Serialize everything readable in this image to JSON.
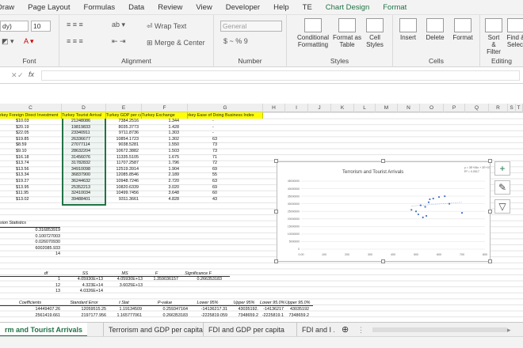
{
  "ribbon_tabs": [
    "Draw",
    "Page Layout",
    "Formulas",
    "Data",
    "Review",
    "View",
    "Developer",
    "Help",
    "TE",
    "Chart Design",
    "Format"
  ],
  "font": {
    "name": "dy)",
    "size": "10",
    "group_label": "Font"
  },
  "alignment": {
    "wrap": "Wrap Text",
    "merge": "Merge & Center",
    "group_label": "Alignment"
  },
  "number": {
    "format": "General",
    "symbols": "$ ~ % 9",
    "group_label": "Number"
  },
  "styles": {
    "cond": "Conditional Formatting",
    "table": "Format as Table",
    "cell": "Cell Styles",
    "group_label": "Styles"
  },
  "cells": {
    "insert": "Insert",
    "delete": "Delete",
    "format": "Format",
    "group_label": "Cells"
  },
  "editing": {
    "sort": "Sort & Filter",
    "find": "Find & Select",
    "group_label": "Editing"
  },
  "formula_bar": {
    "fx": "fx"
  },
  "columns": [
    "C",
    "D",
    "E",
    "F",
    "G",
    "H",
    "I",
    "J",
    "K",
    "L",
    "M",
    "N",
    "O",
    "P",
    "Q",
    "R",
    "S",
    "T"
  ],
  "headers": [
    "rkey Foreign Direct Investment",
    "Turkey Tourist Arrival",
    "Turkey GDP per capit",
    "Turkey Exchange",
    "rkey Ease of Doing Business Index"
  ],
  "rows": [
    [
      "$10.03",
      "21248086",
      "7384.2516",
      "1.344",
      "-"
    ],
    [
      "$20.19",
      "19819833",
      "8035.3773",
      "1.428",
      "-"
    ],
    [
      "$22.05",
      "23340911",
      "9711.8736",
      "1.303",
      "-"
    ],
    [
      "$19.85",
      "26336677",
      "10854.1723",
      "1.302",
      "63"
    ],
    [
      "$8.59",
      "27077114",
      "9038.5281",
      "1.550",
      "73"
    ],
    [
      "$9.10",
      "28632204",
      "10672.3882",
      "1.503",
      "73"
    ],
    [
      "$16.18",
      "31456076",
      "11335.5105",
      "1.675",
      "71"
    ],
    [
      "$13.74",
      "31782832",
      "11707.2587",
      "1.796",
      "72"
    ],
    [
      "$13.56",
      "34910098",
      "12519.3914",
      "1.904",
      "69"
    ],
    [
      "$13.34",
      "36837900",
      "12085.8546",
      "2.189",
      "55"
    ],
    [
      "$19.27",
      "36244632",
      "10948.7246",
      "2.720",
      "63"
    ],
    [
      "$13.95",
      "25352213",
      "10820.6339",
      "3.020",
      "69"
    ],
    [
      "$11.95",
      "32410034",
      "10499.7456",
      "3.648",
      "60"
    ],
    [
      "$13.02",
      "39488401",
      "9311.3661",
      "4.828",
      "43"
    ]
  ],
  "regression": {
    "title": "sion Statistics",
    "stats": [
      "0.316853919",
      "0.100727003",
      "0.026070930",
      "6002085.933",
      "14"
    ],
    "anova_head": [
      "df",
      "SS",
      "MS",
      "F",
      "Significance F"
    ],
    "anova": [
      [
        "1",
        "4.05930E+13",
        "4.05930E+13",
        "1.359036157",
        "0.266353183"
      ],
      [
        "12",
        "4.323E+14",
        "3.6025E+13",
        "",
        ""
      ],
      [
        "13",
        "4.0326E+14",
        "",
        "",
        ""
      ]
    ],
    "coef_head": [
      "Coefficients",
      "Standard Error",
      "t Stat",
      "P-value",
      "Lower 95%",
      "Upper 95%",
      "Lower 95.0%",
      "Upper 95.0%"
    ],
    "coef": [
      [
        "14449407.26",
        "12059515.25",
        "1.19134509",
        "0.259347164",
        "-14136217.31",
        "43035192.",
        "-14136217",
        "43035192"
      ],
      [
        "2561419.661",
        "2197177.956",
        "1.165777061",
        "0.266353183",
        "-2225819.059",
        "7348659.2",
        "-2225819.1",
        "7348659.2"
      ]
    ]
  },
  "chart_data": {
    "type": "scatter",
    "title": "Terrorism and Tourist Arrivals",
    "equation": "y = 3E+06x + 2E+07",
    "r2": "R² = 0.0517",
    "ylim": [
      0,
      45000000
    ],
    "xlim": [
      0,
      800
    ],
    "y_ticks": [
      "45000000",
      "40000000",
      "35000000",
      "30000000",
      "25000000",
      "20000000",
      "15000000",
      "10000000",
      "5000000",
      "0"
    ],
    "x_ticks": [
      "0.00",
      "1.00",
      "2.00",
      "3.00",
      "4.00",
      "5.00",
      "6.00",
      "7.00",
      "8.00"
    ],
    "x_tick_labels": [
      "0.00",
      "100",
      "200",
      "300",
      "400",
      "500",
      "600",
      "700",
      "800"
    ],
    "points": [
      [
        480,
        26000000
      ],
      [
        500,
        25000000
      ],
      [
        510,
        23000000
      ],
      [
        520,
        29000000
      ],
      [
        530,
        21000000
      ],
      [
        540,
        28000000
      ],
      [
        545,
        22000000
      ],
      [
        555,
        31000000
      ],
      [
        560,
        33000000
      ],
      [
        575,
        33500000
      ],
      [
        600,
        34500000
      ],
      [
        625,
        35000000
      ],
      [
        645,
        30000000
      ],
      [
        700,
        24000000
      ]
    ],
    "trend": [
      [
        480,
        28500000
      ],
      [
        700,
        31000000
      ]
    ]
  },
  "sheet_tabs": [
    "rm and Tourist Arrivals",
    "Terrorism and GDP per capita",
    "FDI and GDP per capita",
    "FDI and I ..."
  ],
  "side_buttons": [
    "+",
    "✎",
    "▽"
  ]
}
